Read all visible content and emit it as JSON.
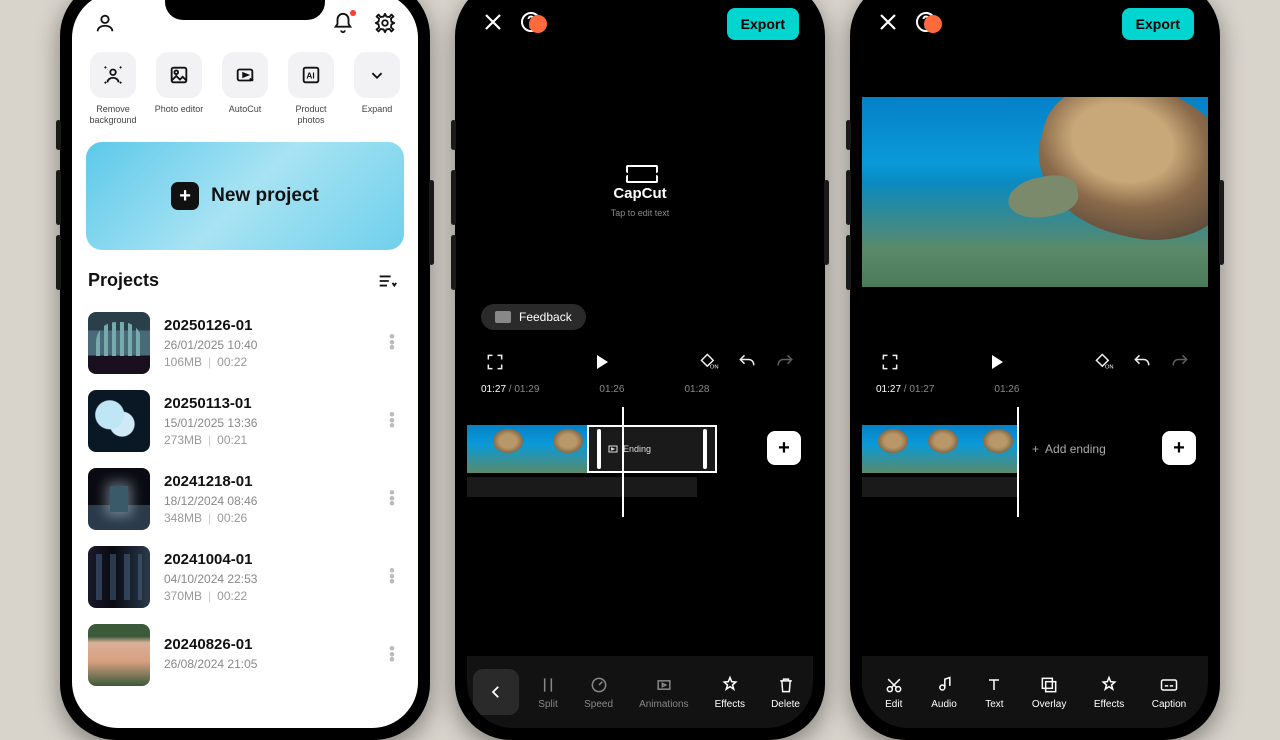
{
  "phone1": {
    "tools": [
      {
        "label": "Remove background"
      },
      {
        "label": "Photo editor"
      },
      {
        "label": "AutoCut"
      },
      {
        "label": "Product photos"
      },
      {
        "label": "Expand"
      }
    ],
    "new_project": "New project",
    "projects_title": "Projects",
    "projects": [
      {
        "title": "20250126-01",
        "date": "26/01/2025 10:40",
        "size": "106MB",
        "dur": "00:22",
        "thumb": "th-church"
      },
      {
        "title": "20250113-01",
        "date": "15/01/2025 13:36",
        "size": "273MB",
        "dur": "00:21",
        "thumb": "th-balloon"
      },
      {
        "title": "20241218-01",
        "date": "18/12/2024 08:46",
        "size": "348MB",
        "dur": "00:26",
        "thumb": "th-city"
      },
      {
        "title": "20241004-01",
        "date": "04/10/2024 22:53",
        "size": "370MB",
        "dur": "00:22",
        "thumb": "th-dark"
      },
      {
        "title": "20240826-01",
        "date": "26/08/2024 21:05",
        "size": "",
        "dur": "",
        "thumb": "th-face"
      }
    ]
  },
  "editor": {
    "export": "Export",
    "brand": "CapCut",
    "tap_hint": "Tap to edit text",
    "feedback": "Feedback",
    "time_current": "01:27",
    "time_total": "01:29",
    "time_total_p3": "01:27",
    "tick1": "01:26",
    "tick2": "01:28",
    "ending_clip": "Ending",
    "add_ending": "Add ending",
    "tools_sel": [
      {
        "label": "Split"
      },
      {
        "label": "Speed"
      },
      {
        "label": "Animations"
      },
      {
        "label": "Effects"
      },
      {
        "label": "Delete"
      }
    ],
    "tools_main": [
      {
        "label": "Edit"
      },
      {
        "label": "Audio"
      },
      {
        "label": "Text"
      },
      {
        "label": "Overlay"
      },
      {
        "label": "Effects"
      },
      {
        "label": "Caption"
      }
    ]
  }
}
